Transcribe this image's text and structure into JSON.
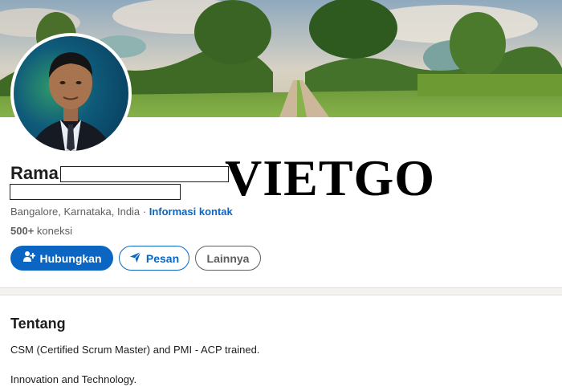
{
  "profile": {
    "name": "Rama",
    "location": "Bangalore, Karnataka, India",
    "separator": " · ",
    "contact_link": "Informasi kontak",
    "connections_count": "500+",
    "connections_label": " koneksi"
  },
  "watermark": "VIETGO",
  "actions": {
    "connect_label": "Hubungkan",
    "message_label": "Pesan",
    "more_label": "Lainnya"
  },
  "about": {
    "title": "Tentang",
    "lines": [
      "CSM (Certified Scrum Master) and PMI - ACP trained.",
      "Innovation and Technology."
    ]
  },
  "colors": {
    "accent": "#0a66c2",
    "text": "#1d1d1d",
    "muted": "#5e5e5e",
    "divider": "#f3f2ef"
  },
  "icons": {
    "connect": "add-person-icon",
    "message": "send-icon"
  }
}
